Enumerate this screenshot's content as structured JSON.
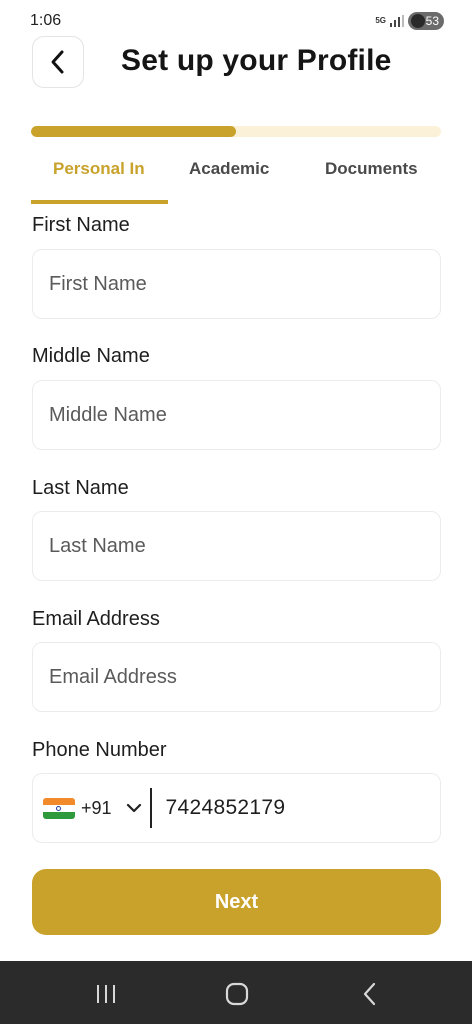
{
  "status_bar": {
    "time": "1:06",
    "network": "5G",
    "battery": "53"
  },
  "header": {
    "title": "Set up your Profile",
    "back_icon": "chevron-left-icon"
  },
  "progress": {
    "fraction": 0.5
  },
  "tabs": [
    {
      "label": "Personal Information",
      "active": true
    },
    {
      "label": "Academic",
      "active": false
    },
    {
      "label": "Documents",
      "active": false
    }
  ],
  "form": {
    "first_name": {
      "label": "First Name",
      "placeholder": "First Name",
      "value": ""
    },
    "middle_name": {
      "label": "Middle Name",
      "placeholder": "Middle Name",
      "value": ""
    },
    "last_name": {
      "label": "Last Name",
      "placeholder": "Last Name",
      "value": ""
    },
    "email": {
      "label": "Email Address",
      "placeholder": "Email Address",
      "value": ""
    },
    "phone": {
      "label": "Phone Number",
      "country_code": "+91",
      "value": "7424852179"
    }
  },
  "next_button": {
    "label": "Next"
  },
  "colors": {
    "accent": "#c9a22c",
    "progress_track": "#faf1d8",
    "nav_bar": "#2b2b2b"
  }
}
